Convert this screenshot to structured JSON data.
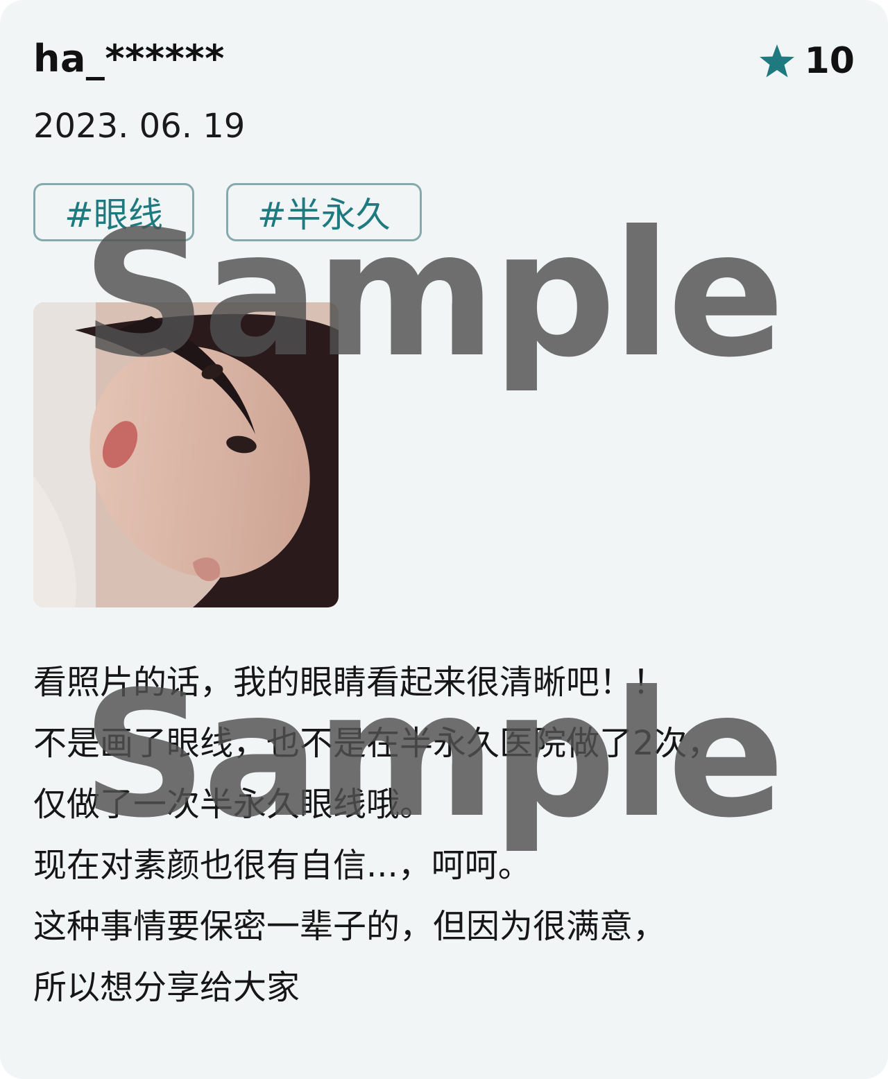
{
  "review": {
    "username": "ha_******",
    "date": "2023. 06. 19",
    "rating": "10",
    "rating_icon": "star-icon",
    "accent_color": "#1f7a80",
    "tags": [
      "#眼线",
      "#半永久"
    ],
    "photo_alt": "review photo",
    "text_lines": [
      "看照片的话，我的眼睛看起来很清晰吧！！",
      "不是画了眼线，也不是在半永久医院做了2次，",
      "仅做了一次半永久眼线哦。",
      "现在对素颜也很有自信...，呵呵。",
      "这种事情要保密一辈子的，但因为很满意，",
      "所以想分享给大家"
    ]
  },
  "watermark": {
    "text": "Sample"
  }
}
